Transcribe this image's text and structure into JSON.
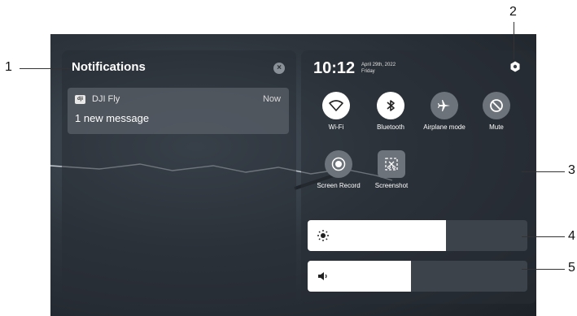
{
  "notifications": {
    "title": "Notifications",
    "items": [
      {
        "app": "DJI Fly",
        "time": "Now",
        "message": "1 new message"
      }
    ]
  },
  "control_center": {
    "time": "10:12",
    "date_line1": "April 29th, 2022",
    "date_line2": "Friday",
    "tiles": [
      {
        "label": "Wi-Fi",
        "state": "on",
        "icon": "wifi-icon"
      },
      {
        "label": "Bluetooth",
        "state": "on",
        "icon": "bluetooth-icon"
      },
      {
        "label": "Airplane mode",
        "state": "off",
        "icon": "airplane-icon"
      },
      {
        "label": "Mute",
        "state": "off",
        "icon": "mute-icon"
      },
      {
        "label": "Screen Record",
        "state": "off",
        "icon": "record-icon"
      },
      {
        "label": "Screenshot",
        "state": "off",
        "icon": "screenshot-icon"
      }
    ],
    "brightness_level": 0.63,
    "volume_level": 0.47
  },
  "callouts": [
    "1",
    "2",
    "3",
    "4",
    "5"
  ]
}
